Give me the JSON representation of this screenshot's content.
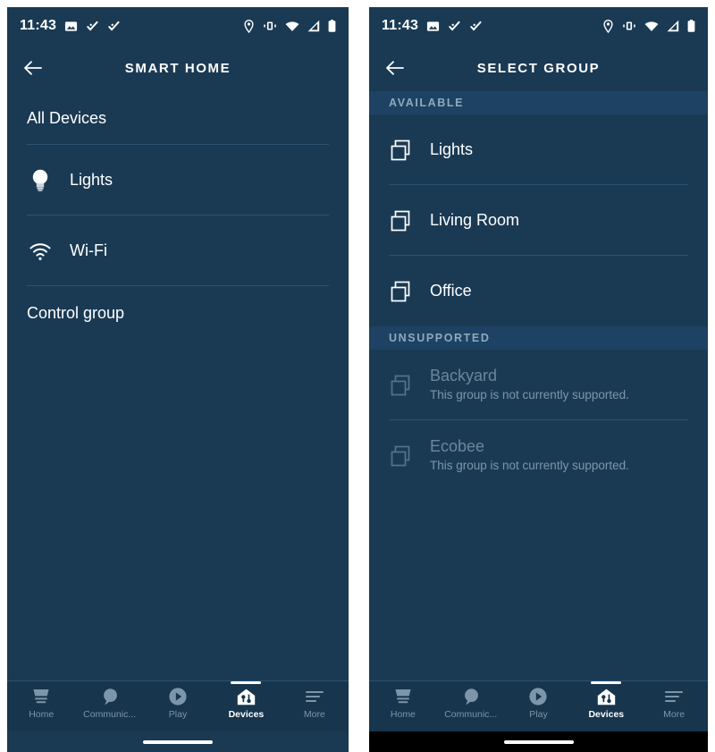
{
  "theme": {
    "background": "#1a3a54",
    "section_header_bg": "#1e4263",
    "divider": "#2b5273",
    "navbar_bg": "#17354d",
    "text_primary": "#ffffff",
    "text_muted": "#7e96a9",
    "text_disabled": "#6e8599"
  },
  "status_bar": {
    "time": "11:43",
    "left_icons": [
      "image-icon",
      "check-activity-icon",
      "check-activity-icon"
    ],
    "right_icons": [
      "location-pin-icon",
      "vibrate-icon",
      "wifi-icon",
      "cellular-signal-icon",
      "battery-icon"
    ]
  },
  "left_screen": {
    "header": {
      "title": "SMART HOME",
      "back_icon": "back-arrow-icon"
    },
    "items": [
      {
        "label": "All Devices",
        "icon": null
      },
      {
        "label": "Lights",
        "icon": "lightbulb-icon"
      },
      {
        "label": "Wi-Fi",
        "icon": "wifi-icon"
      },
      {
        "label": "Control group",
        "icon": null
      }
    ]
  },
  "right_screen": {
    "header": {
      "title": "SELECT GROUP",
      "back_icon": "back-arrow-icon"
    },
    "sections": [
      {
        "title": "AVAILABLE",
        "items": [
          {
            "label": "Lights",
            "subtitle": "",
            "icon": "group-squares-icon",
            "enabled": true
          },
          {
            "label": "Living Room",
            "subtitle": "",
            "icon": "group-squares-icon",
            "enabled": true
          },
          {
            "label": "Office",
            "subtitle": "",
            "icon": "group-squares-icon",
            "enabled": true
          }
        ]
      },
      {
        "title": "UNSUPPORTED",
        "items": [
          {
            "label": "Backyard",
            "subtitle": "This group is not currently supported.",
            "icon": "group-squares-icon",
            "enabled": false
          },
          {
            "label": "Ecobee",
            "subtitle": "This group is not currently supported.",
            "icon": "group-squares-icon",
            "enabled": false
          }
        ]
      }
    ]
  },
  "bottom_nav": {
    "items": [
      {
        "label": "Home",
        "icon": "home-icon",
        "active": false
      },
      {
        "label": "Communic...",
        "icon": "chat-bubble-icon",
        "active": false
      },
      {
        "label": "Play",
        "icon": "play-circle-icon",
        "active": false
      },
      {
        "label": "Devices",
        "icon": "devices-house-icon",
        "active": true
      },
      {
        "label": "More",
        "icon": "hamburger-menu-icon",
        "active": false
      }
    ]
  }
}
